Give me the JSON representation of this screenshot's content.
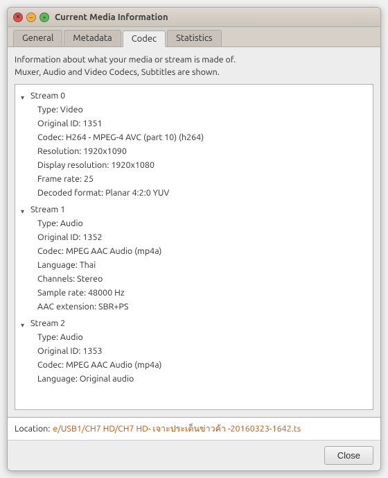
{
  "window": {
    "title": "Current Media Information"
  },
  "tabs": [
    {
      "id": "general",
      "label": "General",
      "active": false
    },
    {
      "id": "metadata",
      "label": "Metadata",
      "active": false
    },
    {
      "id": "codec",
      "label": "Codec",
      "active": true
    },
    {
      "id": "statistics",
      "label": "Statistics",
      "active": false
    }
  ],
  "info": {
    "line1": "Information about what your media or stream is made of.",
    "line2": "Muxer, Audio and Video Codecs, Subtitles are shown."
  },
  "streams": [
    {
      "header": "Stream 0",
      "props": [
        "Type: Video",
        "Original ID: 1351",
        "Codec: H264 - MPEG-4 AVC (part 10) (h264)",
        "Resolution: 1920x1090",
        "Display resolution: 1920x1080",
        "Frame rate: 25",
        "Decoded format: Planar 4:2:0 YUV"
      ]
    },
    {
      "header": "Stream 1",
      "props": [
        "Type: Audio",
        "Original ID: 1352",
        "Codec: MPEG AAC Audio (mp4a)",
        "Language: Thai",
        "Channels: Stereo",
        "Sample rate: 48000 Hz",
        "AAC extension: SBR+PS"
      ]
    },
    {
      "header": "Stream 2",
      "props": [
        "Type: Audio",
        "Original ID: 1353",
        "Codec: MPEG AAC Audio (mp4a)",
        "Language: Original audio"
      ]
    }
  ],
  "location": {
    "label": "Location:",
    "value": "e/USB1/CH7 HD/CH7 HD- เจาะประเด็นข่าวค้า -20160323-1642.ts"
  },
  "buttons": {
    "close": "Close"
  }
}
